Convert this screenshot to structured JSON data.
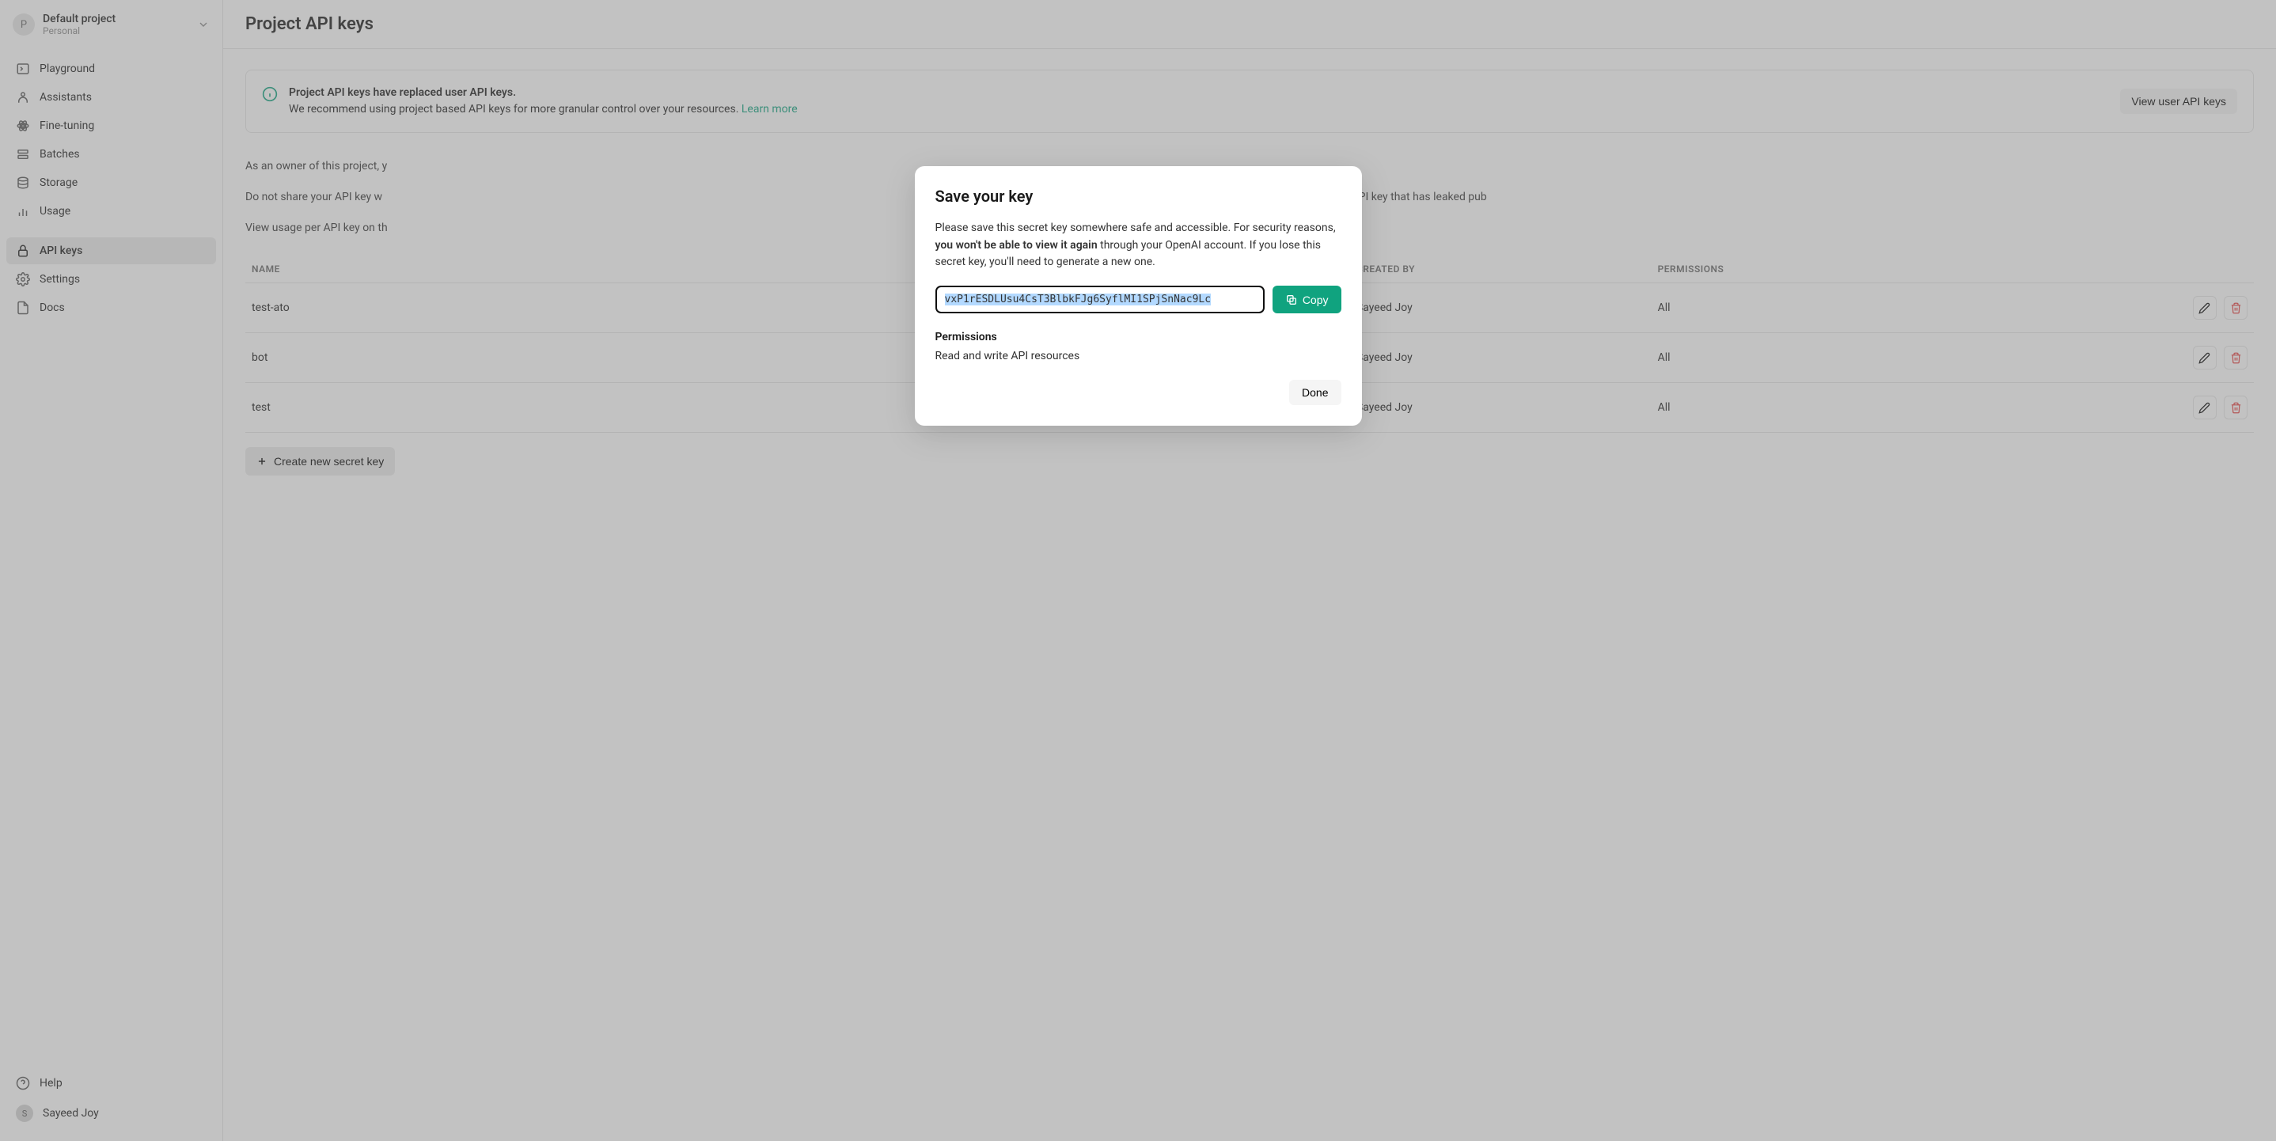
{
  "sidebar": {
    "project": {
      "avatar_letter": "P",
      "name": "Default project",
      "sublabel": "Personal"
    },
    "nav": [
      {
        "icon": "terminal-icon",
        "label": "Playground"
      },
      {
        "icon": "robot-icon",
        "label": "Assistants"
      },
      {
        "icon": "atom-icon",
        "label": "Fine-tuning"
      },
      {
        "icon": "layers-icon",
        "label": "Batches"
      },
      {
        "icon": "database-icon",
        "label": "Storage"
      },
      {
        "icon": "chart-icon",
        "label": "Usage"
      }
    ],
    "nav2": [
      {
        "icon": "lock-icon",
        "label": "API keys",
        "active": true
      },
      {
        "icon": "gear-icon",
        "label": "Settings"
      },
      {
        "icon": "doc-icon",
        "label": "Docs"
      }
    ],
    "footer": {
      "help_label": "Help",
      "user_name": "Sayeed Joy",
      "user_initial": "S"
    }
  },
  "page": {
    "title": "Project API keys",
    "banner": {
      "title": "Project API keys have replaced user API keys.",
      "desc": "We recommend using project based API keys for more granular control over your resources. ",
      "link_label": "Learn more",
      "button_label": "View user API keys"
    },
    "paragraphs": {
      "p1": "As an owner of this project, y",
      "p2": "Do not share your API key w",
      "p2b": "security of your account, OpenAI may also automatically disable any API key that has leaked pub",
      "p3": "View usage per API key on th"
    },
    "table": {
      "headers": {
        "name": "NAME",
        "created_by": "CREATED BY",
        "permissions": "PERMISSIONS"
      },
      "rows": [
        {
          "name": "test-ato",
          "created_by": "Sayeed Joy",
          "permissions": "All"
        },
        {
          "name": "bot",
          "created_by": "Sayeed Joy",
          "permissions": "All"
        },
        {
          "name": "test",
          "created_by": "Sayeed Joy",
          "permissions": "All"
        }
      ]
    },
    "create_button_label": "Create new secret key"
  },
  "modal": {
    "title": "Save your key",
    "desc_a": "Please save this secret key somewhere safe and accessible. For security reasons, ",
    "desc_bold": "you won't be able to view it again",
    "desc_b": " through your OpenAI account. If you lose this secret key, you'll need to generate a new one.",
    "key_value": "vxP1rESDLUsu4CsT3BlbkFJg6SyflMI1SPjSnNac9Lc",
    "copy_label": "Copy",
    "permissions_heading": "Permissions",
    "permissions_value": "Read and write API resources",
    "done_label": "Done"
  }
}
